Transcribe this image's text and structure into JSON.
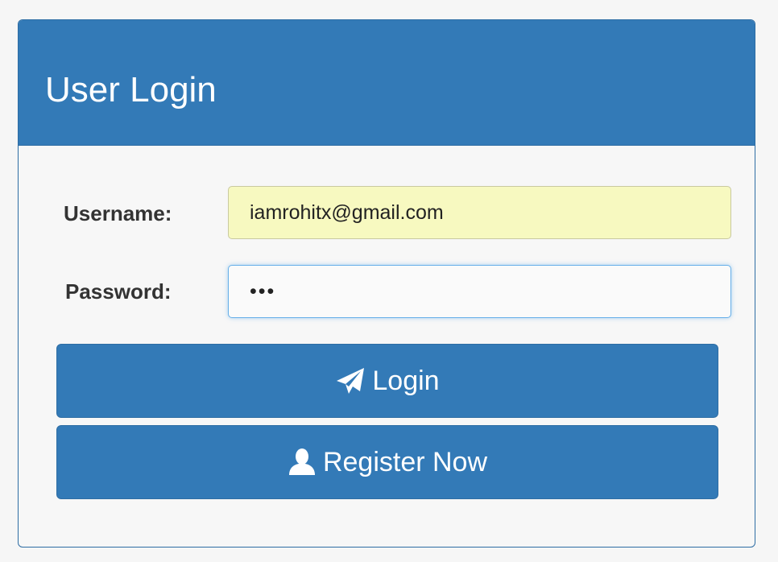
{
  "panel": {
    "title": "User Login"
  },
  "form": {
    "username_label": "Username:",
    "username_value": "iamrohitx@gmail.com",
    "password_label": "Password:",
    "password_value": "•••"
  },
  "buttons": {
    "login_label": "Login",
    "login_icon": "paper-plane-icon",
    "register_label": "Register Now",
    "register_icon": "user-icon"
  },
  "colors": {
    "primary": "#337ab7",
    "autofill_background": "#f7f9c0",
    "focus_border": "#66afe9"
  }
}
